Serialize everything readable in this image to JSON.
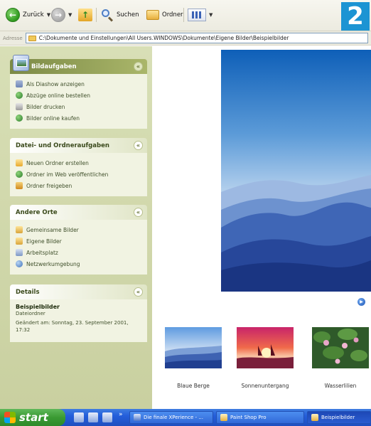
{
  "toolbar": {
    "back_label": "Zurück",
    "search_label": "Suchen",
    "folders_label": "Ordner",
    "badge": "2"
  },
  "address": {
    "label": "Adresse",
    "path": "C:\\Dokumente und Einstellungen\\All Users.WINDOWS\\Dokumente\\Eigene Bilder\\Beispielbilder"
  },
  "panels": {
    "picture_tasks": {
      "title": "Bildaufgaben",
      "items": [
        "Als Diashow anzeigen",
        "Abzüge online bestellen",
        "Bilder drucken",
        "Bilder online kaufen"
      ]
    },
    "file_folder_tasks": {
      "title": "Datei- und Ordneraufgaben",
      "items": [
        "Neuen Ordner erstellen",
        "Ordner im Web veröffentlichen",
        "Ordner freigeben"
      ]
    },
    "other_places": {
      "title": "Andere Orte",
      "items": [
        "Gemeinsame Bilder",
        "Eigene Bilder",
        "Arbeitsplatz",
        "Netzwerkumgebung"
      ]
    },
    "details": {
      "title": "Details",
      "name": "Beispielbilder",
      "type": "Dateiordner",
      "modified": "Geändert am: Sonntag, 23. September 2001, 17:32"
    }
  },
  "thumbnails": [
    {
      "label": "Blaue Berge"
    },
    {
      "label": "Sonnenuntergang"
    },
    {
      "label": "Wasserlilien"
    }
  ],
  "taskbar": {
    "start_label": "start",
    "tasks": [
      {
        "label": "Die finale XPerience - ..."
      },
      {
        "label": "Paint Shop Pro"
      },
      {
        "label": "Beispielbilder"
      }
    ]
  },
  "colors": {
    "left_pane": "#d3daa9",
    "taskbar": "#245edb",
    "badge": "#1c94d3"
  }
}
